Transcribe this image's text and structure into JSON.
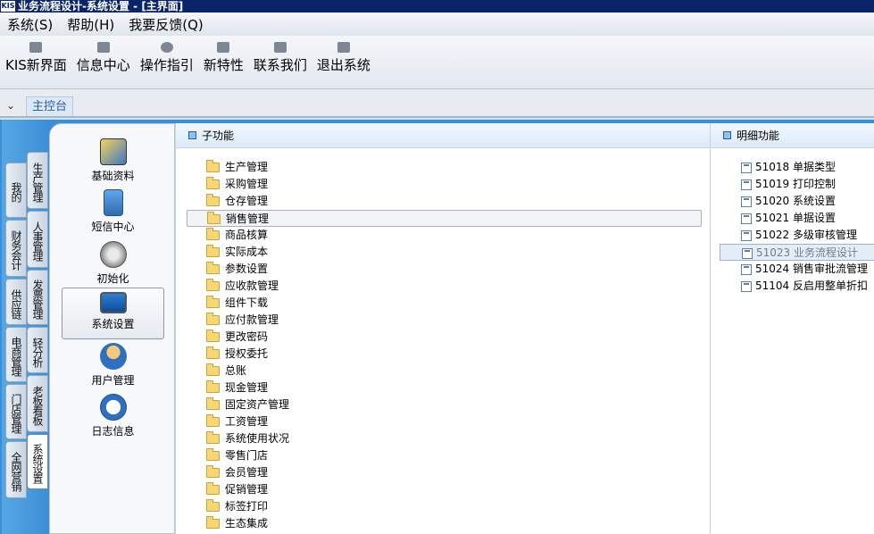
{
  "window": {
    "title": "业务流程设计-系统设置 - [主界面]",
    "logo": "KIS"
  },
  "menu": [
    "系统(S)",
    "帮助(H)",
    "我要反馈(Q)"
  ],
  "toolbar": [
    {
      "label": "KIS新界面",
      "icon": "kis-home-icon"
    },
    {
      "label": "信息中心",
      "icon": "envelope-icon"
    },
    {
      "label": "操作指引",
      "icon": "compass-icon"
    },
    {
      "label": "新特性",
      "icon": "gift-icon"
    },
    {
      "label": "联系我们",
      "icon": "chat-icon"
    },
    {
      "label": "退出系统",
      "icon": "exit-icon"
    }
  ],
  "tabs": {
    "active": "主控台"
  },
  "left_tabs_outer": [
    "我的KIS",
    "财务会计",
    "供应链",
    "电商管理",
    "门店管理",
    "全网营销"
  ],
  "left_tabs_inner": [
    "生产管理",
    "人事管理",
    "发票管理",
    "轻分析",
    "老板看板",
    "系统设置"
  ],
  "nav_items": [
    "基础资料",
    "短信中心",
    "初始化",
    "系统设置",
    "用户管理",
    "日志信息"
  ],
  "panels": {
    "sub": "子功能",
    "detail": "明细功能"
  },
  "sub_functions": [
    "生产管理",
    "采购管理",
    "仓存管理",
    "销售管理",
    "商品核算",
    "实际成本",
    "参数设置",
    "应收款管理",
    "组件下载",
    "应付款管理",
    "更改密码",
    "授权委托",
    "总账",
    "现金管理",
    "固定资产管理",
    "工资管理",
    "系统使用状况",
    "零售门店",
    "会员管理",
    "促销管理",
    "标签打印",
    "生态集成"
  ],
  "details": [
    {
      "code": "51018",
      "name": "单据类型"
    },
    {
      "code": "51019",
      "name": "打印控制"
    },
    {
      "code": "51020",
      "name": "系统设置"
    },
    {
      "code": "51021",
      "name": "单据设置"
    },
    {
      "code": "51022",
      "name": "多级审核管理"
    },
    {
      "code": "51023",
      "name": "业务流程设计"
    },
    {
      "code": "51024",
      "name": "销售审批流管理"
    },
    {
      "code": "51104",
      "name": "反启用整单折扣"
    }
  ],
  "selected": {
    "sub": "销售管理",
    "detail": "51023",
    "nav": "系统设置",
    "inner_tab": "系统设置"
  }
}
